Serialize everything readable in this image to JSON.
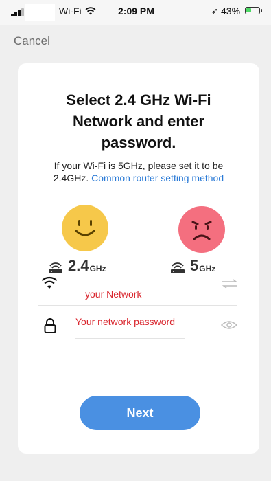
{
  "status_bar": {
    "network": "Wi-Fi",
    "time": "2:09 PM",
    "battery": "43%",
    "battery_level": 0.43,
    "location_glyph": "➶"
  },
  "nav": {
    "cancel_label": "Cancel"
  },
  "card": {
    "title": "Select 2.4 GHz Wi-Fi Network and enter password.",
    "description": "If your Wi-Fi is 5GHz, please set it to be 2.4GHz. ",
    "description_link": "Common router setting method",
    "bands": [
      {
        "number": "2.4",
        "unit": "GHz",
        "face": "happy-face-icon",
        "color": "#f6c84a"
      },
      {
        "number": "5",
        "unit": "GHz",
        "face": "sad-face-icon",
        "color": "#f46f7f"
      }
    ],
    "network_value": "your Network",
    "password_value": "Your network password",
    "next_label": "Next"
  },
  "colors": {
    "accent": "#4a90e2",
    "link": "#2a7ad6",
    "field_text": "#d9262e",
    "background": "#efefef"
  },
  "icons": [
    "cellular-signal-icon",
    "wifi-status-icon",
    "location-arrow-icon",
    "battery-icon",
    "router-icon",
    "wifi-icon",
    "switch-network-icon",
    "lock-icon",
    "eye-icon"
  ]
}
